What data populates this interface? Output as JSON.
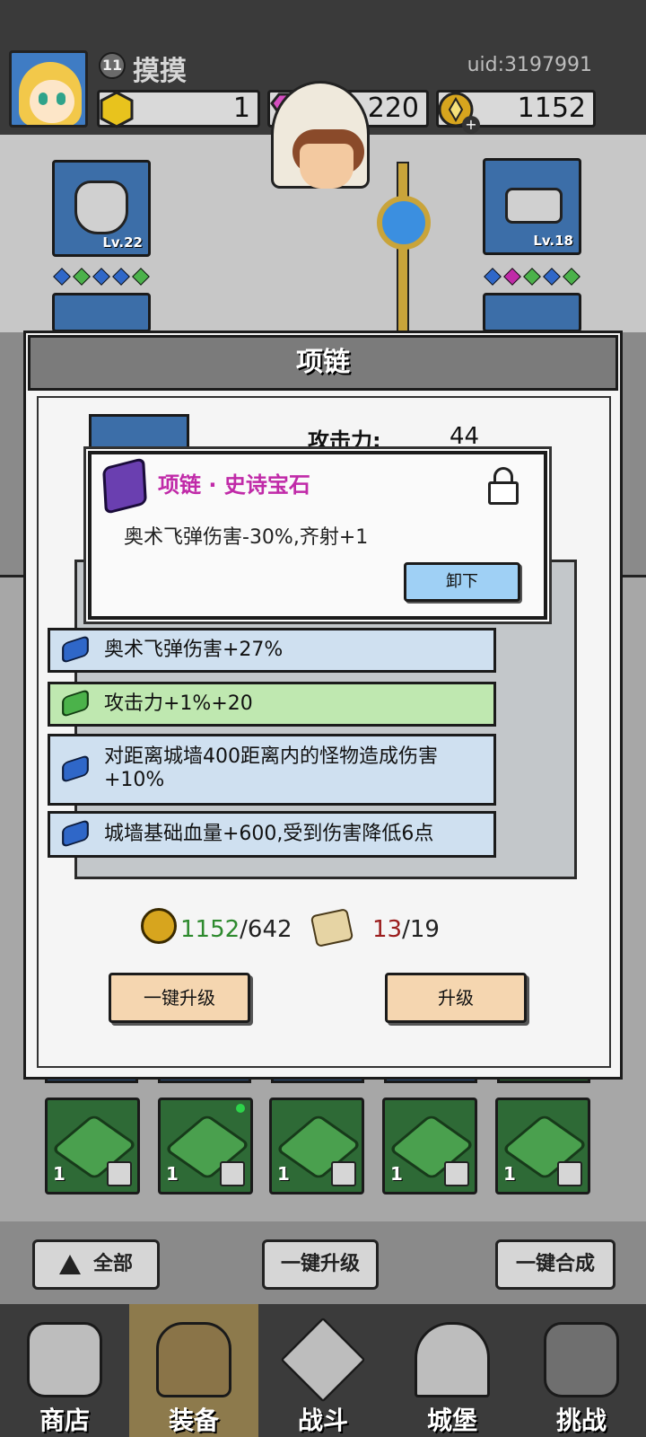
{
  "profile": {
    "level": "11",
    "nickname": "摸摸",
    "uid": "uid:3197991"
  },
  "resources": [
    {
      "name": "gold-gem",
      "value": "1"
    },
    {
      "name": "purple-diamond",
      "value": "220"
    },
    {
      "name": "gold-coin",
      "value": "1152"
    }
  ],
  "equipment_slots": {
    "left_top": {
      "level": "Lv.22"
    },
    "right_top": {
      "level": "Lv.18"
    },
    "left_gems": [
      "#2f67c8",
      "#4bb24a",
      "#2f67c8",
      "#2f67c8",
      "#4bb24a"
    ],
    "right_gems": [
      "#2f67c8",
      "#c02aa8",
      "#4bb24a",
      "#2f67c8",
      "#4bb24a"
    ]
  },
  "modal": {
    "title": "项链",
    "attack_label": "攻击力:",
    "attack_value": "44",
    "stats": [
      {
        "text": "奥术飞弹伤害+27%",
        "color": "blue"
      },
      {
        "text": "攻击力+1%+20",
        "color": "green"
      },
      {
        "text": "对距离城墙400距离内的怪物造成伤害+10%",
        "color": "blue"
      },
      {
        "text": "城墙基础血量+600,受到伤害降低6点",
        "color": "blue"
      }
    ],
    "cost": {
      "coin_have": "1152",
      "coin_need": "/642",
      "scroll_have": "13",
      "scroll_need": "/19"
    },
    "buttons": {
      "upgrade_all": "一键升级",
      "upgrade": "升级"
    }
  },
  "tooltip": {
    "title": "项链 · 史诗宝石",
    "description": "奥术飞弹伤害-30%,齐射+1",
    "unequip": "卸下"
  },
  "inventory": {
    "items": [
      {
        "count": "1"
      },
      {
        "count": "1"
      },
      {
        "count": "1"
      },
      {
        "count": "1"
      },
      {
        "count": "1"
      }
    ]
  },
  "actions": {
    "all": "全部",
    "upgrade_all": "一键升级",
    "merge_all": "一键合成"
  },
  "nav": [
    {
      "label": "商店"
    },
    {
      "label": "装备"
    },
    {
      "label": "战斗"
    },
    {
      "label": "城堡"
    },
    {
      "label": "挑战"
    }
  ]
}
